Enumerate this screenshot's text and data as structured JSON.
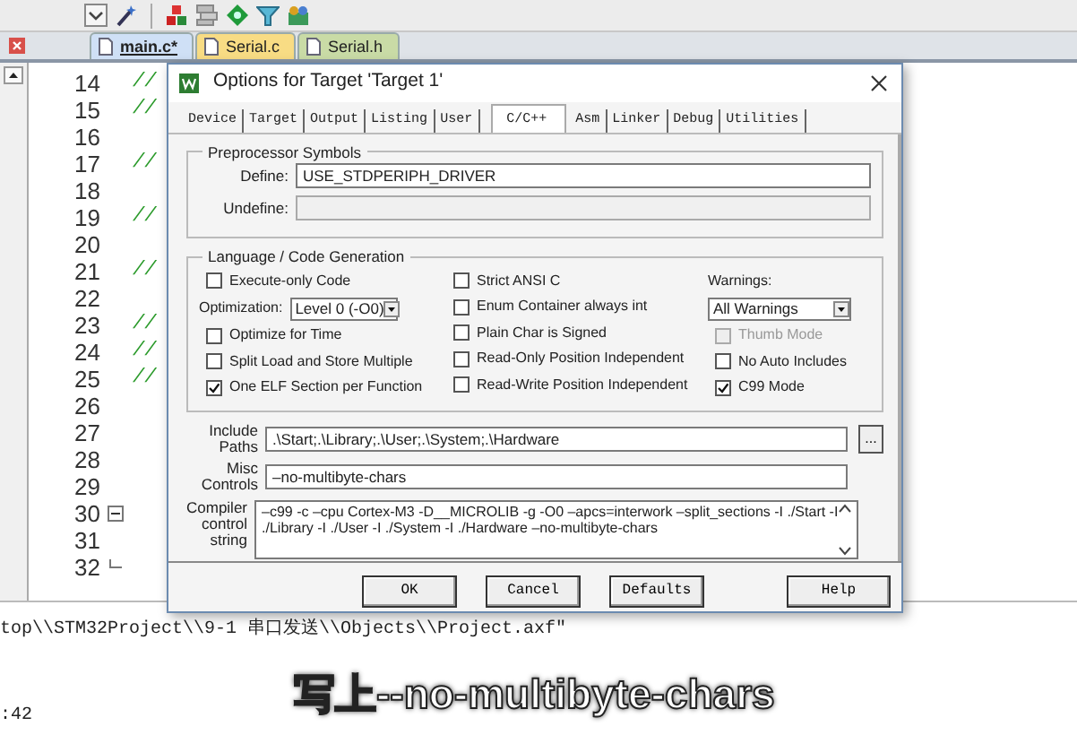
{
  "file_tabs": [
    {
      "label": "main.c*",
      "selected": true,
      "color": "#cfe0f6"
    },
    {
      "label": "Serial.c",
      "selected": false,
      "color": "#f8dc84"
    },
    {
      "label": "Serial.h",
      "selected": false,
      "color": "#c9dba6"
    }
  ],
  "editor": {
    "lines": [
      {
        "number": "14",
        "text": "//"
      },
      {
        "number": "15",
        "text": "//"
      },
      {
        "number": "16"
      },
      {
        "number": "17",
        "text": "//"
      },
      {
        "number": "18"
      },
      {
        "number": "19",
        "text": "//"
      },
      {
        "number": "20"
      },
      {
        "number": "21",
        "text": "//"
      },
      {
        "number": "22"
      },
      {
        "number": "23",
        "text": "//"
      },
      {
        "number": "24",
        "text": "//"
      },
      {
        "number": "25",
        "text": "//"
      },
      {
        "number": "26"
      },
      {
        "number": "27"
      },
      {
        "number": "28"
      },
      {
        "number": "29"
      },
      {
        "number": "30",
        "fold_start": true
      },
      {
        "number": "31"
      },
      {
        "number": "32",
        "fold_end": true
      }
    ]
  },
  "output": {
    "lines": [
      "top\\\\STM32Project\\\\9-1 串口发送\\\\Objects\\\\Project.axf\"",
      ":42"
    ]
  },
  "dialog": {
    "title": "Options for Target 'Target 1'",
    "tabs": [
      {
        "label": "Device",
        "selected": false
      },
      {
        "label": "Target",
        "selected": false
      },
      {
        "label": "Output",
        "selected": false
      },
      {
        "label": "Listing",
        "selected": false
      },
      {
        "label": "User",
        "selected": false
      },
      {
        "label": "C/C++",
        "selected": true
      },
      {
        "label": "Asm",
        "selected": false
      },
      {
        "label": "Linker",
        "selected": false
      },
      {
        "label": "Debug",
        "selected": false
      },
      {
        "label": "Utilities",
        "selected": false
      }
    ],
    "preprocessor": {
      "title": "Preprocessor Symbols",
      "define": {
        "label": "Define:",
        "value": "USE_STDPERIPH_DRIVER",
        "disabled": false
      },
      "undefine": {
        "label": "Undefine:",
        "disabled": true
      }
    },
    "language": {
      "title": "Language / Code Generation",
      "columns": [
        [
          {
            "kind": "checkbox",
            "label": "Execute-only Code",
            "checked": false,
            "disabled": false
          },
          {
            "kind": "select",
            "label": "Optimization:",
            "value": "Level 0 (-O0)"
          },
          {
            "kind": "checkbox",
            "label": "Optimize for Time",
            "checked": false,
            "disabled": false
          },
          {
            "kind": "checkbox",
            "label": "Split Load and Store Multiple",
            "checked": false,
            "disabled": false
          },
          {
            "kind": "checkbox",
            "label": "One ELF Section per Function",
            "checked": true,
            "disabled": false
          }
        ],
        [
          {
            "kind": "checkbox",
            "label": "Strict ANSI C",
            "checked": false,
            "disabled": false
          },
          {
            "kind": "checkbox",
            "label": "Enum Container always int",
            "checked": false,
            "disabled": false
          },
          {
            "kind": "checkbox",
            "label": "Plain Char is Signed",
            "checked": false,
            "disabled": false
          },
          {
            "kind": "checkbox",
            "label": "Read-Only Position Independent",
            "checked": false,
            "disabled": false
          },
          {
            "kind": "checkbox",
            "label": "Read-Write Position Independent",
            "checked": false,
            "disabled": false
          }
        ],
        [
          {
            "kind": "label",
            "label": "Warnings:"
          },
          {
            "kind": "select",
            "value": "All Warnings"
          },
          {
            "kind": "checkbox",
            "label": "Thumb Mode",
            "checked": false,
            "disabled": true
          },
          {
            "kind": "checkbox",
            "label": "No Auto Includes",
            "checked": false,
            "disabled": false
          },
          {
            "kind": "checkbox",
            "label": "C99 Mode",
            "checked": true,
            "disabled": false
          }
        ]
      ]
    },
    "fields": [
      {
        "kind": "path",
        "label": "Include Paths",
        "value": ".\\Start;.\\Library;.\\User;.\\System;.\\Hardware",
        "browse": "..."
      },
      {
        "kind": "text",
        "label": "Misc Controls",
        "value": "–no-multibyte-chars"
      },
      {
        "kind": "string",
        "label": "Compiler control string",
        "value": "–c99 -c –cpu Cortex-M3 -D__MICROLIB -g -O0 –apcs=interwork –split_sections -I ./Start -I ./Library -I ./User -I ./System -I ./Hardware –no-multibyte-chars"
      }
    ],
    "buttons": [
      "OK",
      "Cancel",
      "Defaults",
      "Help"
    ]
  },
  "caption": "写上--no-multibyte-chars"
}
